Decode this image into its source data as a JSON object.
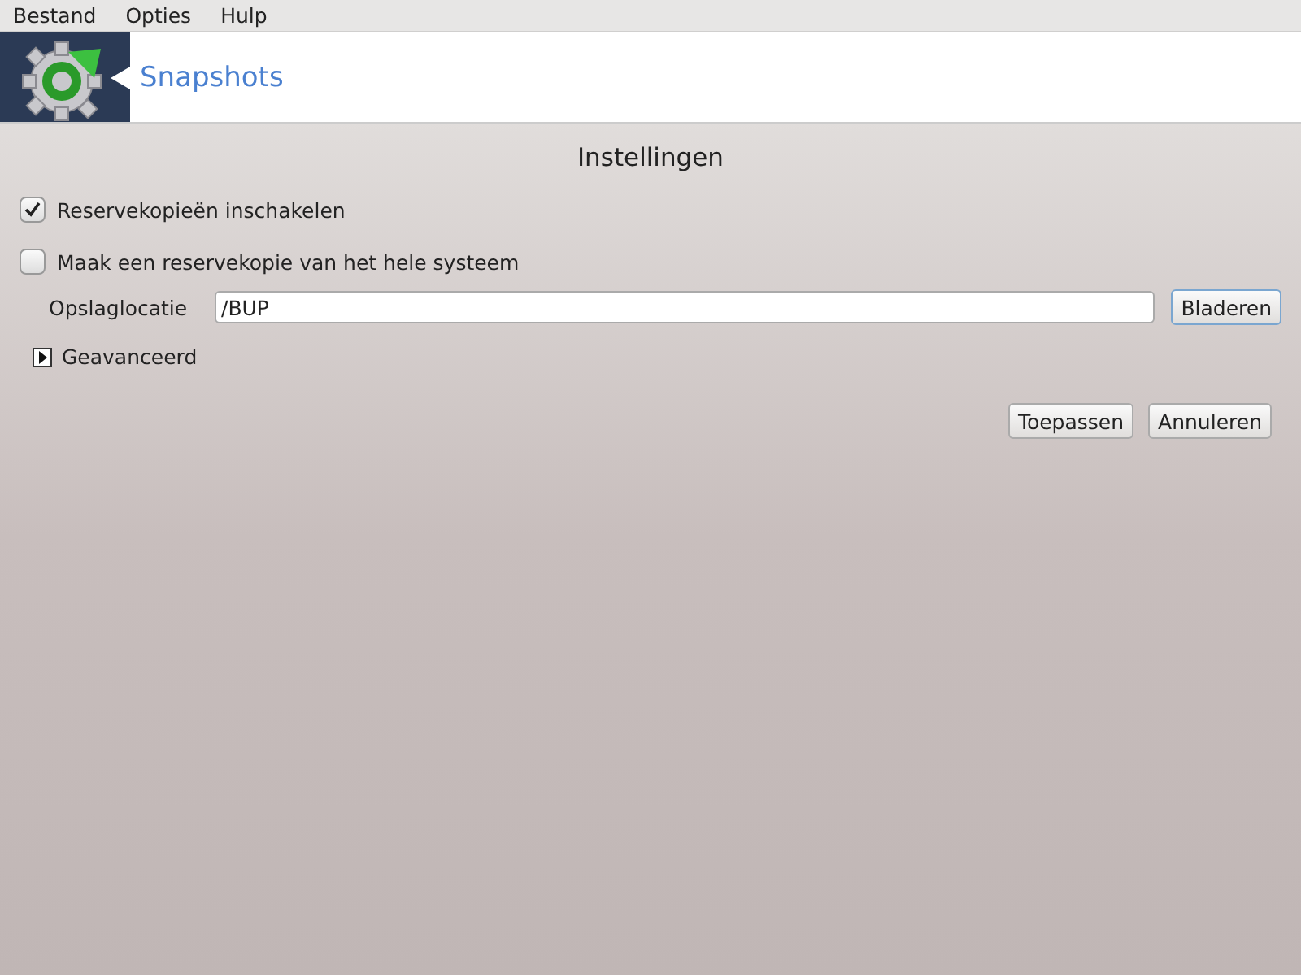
{
  "menu": [
    {
      "label": "Bestand"
    },
    {
      "label": "Opties"
    },
    {
      "label": "Hulp"
    }
  ],
  "header": {
    "title": "Snapshots"
  },
  "section_title": "Instellingen",
  "options": [
    {
      "label": "Reservekopieën inschakelen",
      "checked": true
    },
    {
      "label": "Maak een reservekopie van het hele systeem",
      "checked": false
    }
  ],
  "storage": {
    "label": "Opslaglocatie",
    "value": "/BUP",
    "button": "Bladeren"
  },
  "advanced": {
    "label": "Geavanceerd",
    "expanded": false
  },
  "buttons": [
    "Toepassen",
    "Annuleren"
  ]
}
